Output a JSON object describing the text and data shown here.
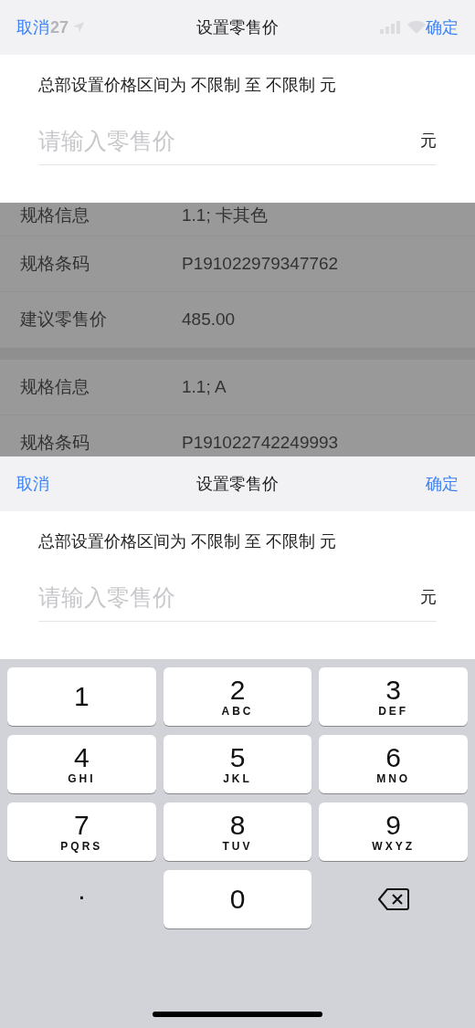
{
  "status_bar": {
    "time": "27"
  },
  "top_sheet": {
    "cancel": "取消",
    "title": "设置零售价",
    "confirm": "确定",
    "range_text": "总部设置价格区间为 不限制 至 不限制 元",
    "input": {
      "placeholder": "请输入零售价"
    },
    "unit": "元"
  },
  "spec_groups": [
    {
      "rows": [
        {
          "label": "规格信息",
          "value": "1.1; 卡其色"
        },
        {
          "label": "规格条码",
          "value": "P191022979347762"
        },
        {
          "label": "建议零售价",
          "value": "485.00"
        }
      ]
    },
    {
      "rows": [
        {
          "label": "规格信息",
          "value": "1.1; A"
        },
        {
          "label": "规格条码",
          "value": "P191022742249993"
        }
      ]
    }
  ],
  "bottom_sheet": {
    "cancel": "取消",
    "title": "设置零售价",
    "confirm": "确定",
    "range_text": "总部设置价格区间为 不限制 至 不限制 元",
    "input": {
      "placeholder": "请输入零售价"
    },
    "unit": "元"
  },
  "keyboard": [
    {
      "kind": "key",
      "digit": "1"
    },
    {
      "kind": "key",
      "digit": "2",
      "letters": "ABC"
    },
    {
      "kind": "key",
      "digit": "3",
      "letters": "DEF"
    },
    {
      "kind": "key",
      "digit": "4",
      "letters": "GHI"
    },
    {
      "kind": "key",
      "digit": "5",
      "letters": "JKL"
    },
    {
      "kind": "key",
      "digit": "6",
      "letters": "MNO"
    },
    {
      "kind": "key",
      "digit": "7",
      "letters": "PQRS"
    },
    {
      "kind": "key",
      "digit": "8",
      "letters": "TUV"
    },
    {
      "kind": "key",
      "digit": "9",
      "letters": "WXYZ"
    },
    {
      "kind": "plain",
      "digit": "."
    },
    {
      "kind": "key",
      "digit": "0"
    },
    {
      "kind": "delete"
    }
  ]
}
